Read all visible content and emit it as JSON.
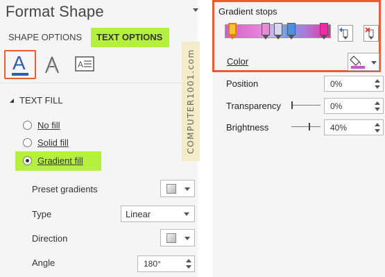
{
  "left_pane": {
    "title": "Format Shape",
    "tabs": [
      {
        "label": "SHAPE OPTIONS",
        "active": false
      },
      {
        "label": "TEXT OPTIONS",
        "active": true
      }
    ],
    "icons": [
      {
        "name": "text-fill-outline-icon",
        "glyph": "A",
        "selected": true
      },
      {
        "name": "text-effects-icon",
        "selected": false
      },
      {
        "name": "textbox-layout-icon",
        "selected": false
      }
    ],
    "section_title": "TEXT FILL",
    "fill_options": [
      {
        "label": "No fill",
        "checked": false
      },
      {
        "label": "Solid fill",
        "checked": false
      },
      {
        "label": "Gradient fill",
        "checked": true
      }
    ],
    "properties": {
      "preset_gradients_label": "Preset gradients",
      "type_label": "Type",
      "type_value": "Linear",
      "direction_label": "Direction",
      "angle_label": "Angle",
      "angle_value": "180°"
    }
  },
  "watermark": "COMPUTER1001.com",
  "right_pane": {
    "gradient_stops_title": "Gradient stops",
    "stops": [
      {
        "color": "#f4c430",
        "selected": true
      },
      {
        "color": "#e88ad8",
        "selected": false
      },
      {
        "color": "#d6d6ee",
        "selected": false
      },
      {
        "color": "#4a90e2",
        "selected": false
      },
      {
        "color": "#f02ba5",
        "selected": false
      }
    ],
    "color_label": "Color",
    "color_value": "#d14fd4",
    "position_label": "Position",
    "position_value": "0%",
    "transparency_label": "Transparency",
    "transparency_value": "0%",
    "brightness_label": "Brightness",
    "brightness_value": "40%"
  },
  "colors": {
    "highlight_green": "#b6f03f",
    "highlight_orange": "#ef5a2e",
    "accent_blue": "#2b5fb0"
  }
}
